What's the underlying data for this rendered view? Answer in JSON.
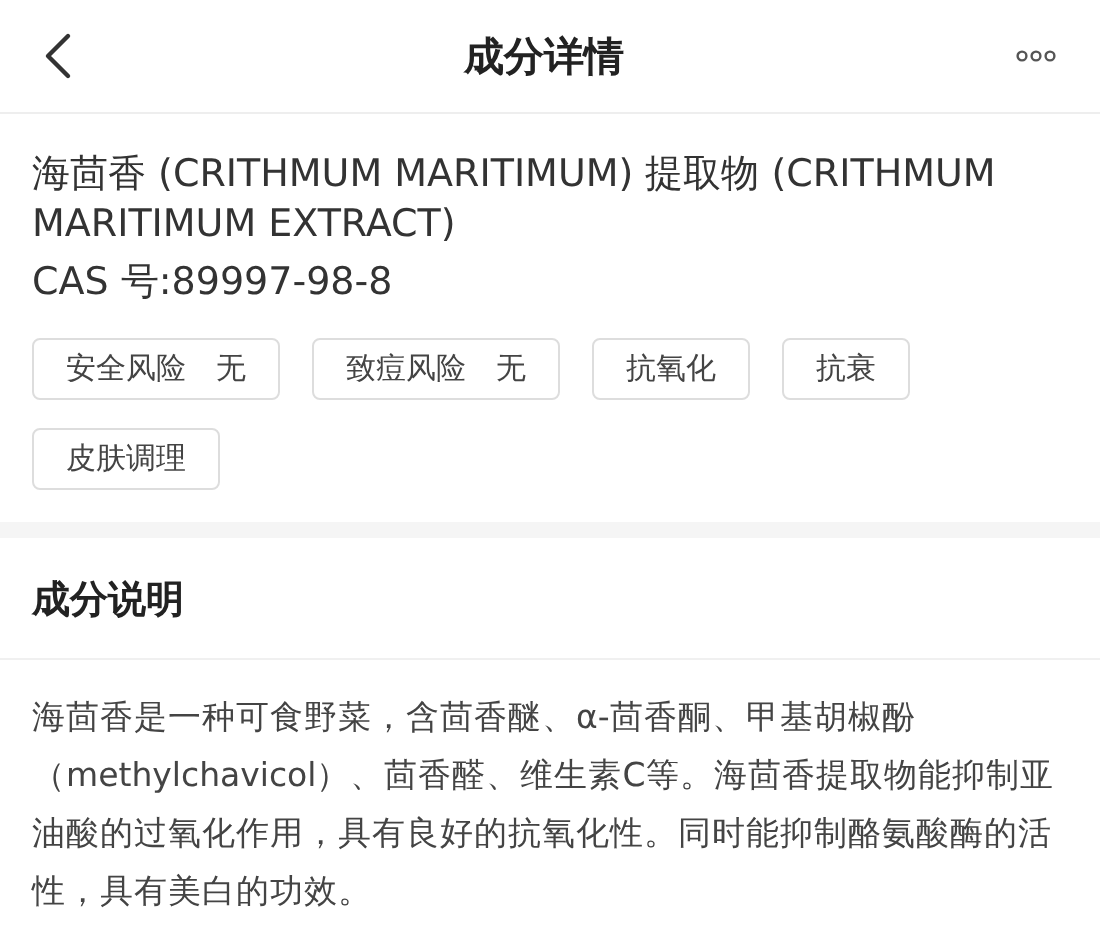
{
  "header": {
    "title": "成分详情"
  },
  "ingredient": {
    "name": "海茴香 (CRITHMUM MARITIMUM) 提取物 (CRITHMUM MARITIMUM EXTRACT)",
    "cas": "CAS 号:89997-98-8"
  },
  "tags": [
    {
      "label": "安全风险",
      "value": "无"
    },
    {
      "label": "致痘风险",
      "value": "无"
    },
    {
      "label": "抗氧化"
    },
    {
      "label": "抗衰"
    },
    {
      "label": "皮肤调理"
    }
  ],
  "section": {
    "title": "成分说明",
    "body": "海茴香是一种可食野菜，含茴香醚、α-茴香酮、甲基胡椒酚（methylchavicol）、茴香醛、维生素C等。海茴香提取物能抑制亚油酸的过氧化作用，具有良好的抗氧化性。同时能抑制酪氨酸酶的活性，具有美白的功效。"
  }
}
